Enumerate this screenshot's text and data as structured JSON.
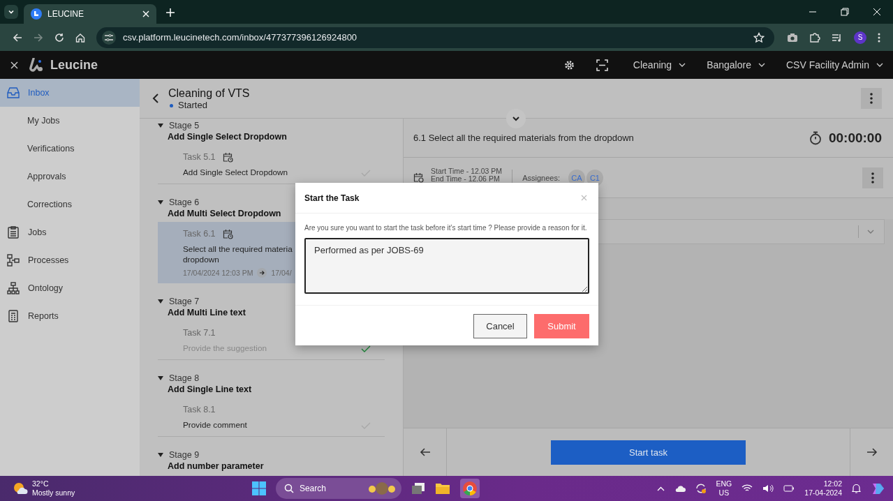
{
  "browser": {
    "tabs": [
      {
        "title": "LEUCINE",
        "selected": true
      }
    ],
    "url": "csv.platform.leucinetech.com/inbox/477377396126924800",
    "profile": "S"
  },
  "header": {
    "brand": "Leucine",
    "selectors": [
      "Cleaning",
      "Bangalore",
      "CSV Facility Admin"
    ]
  },
  "sidebar": {
    "items": [
      {
        "label": "Inbox",
        "kind": "main",
        "selected": true
      },
      {
        "label": "My Jobs",
        "kind": "sub",
        "selected": false
      },
      {
        "label": "Verifications",
        "kind": "sub",
        "selected": false
      },
      {
        "label": "Approvals",
        "kind": "sub",
        "selected": false
      },
      {
        "label": "Corrections",
        "kind": "sub",
        "selected": false
      },
      {
        "label": "Jobs",
        "kind": "main",
        "selected": false
      },
      {
        "label": "Processes",
        "kind": "main",
        "selected": false
      },
      {
        "label": "Ontology",
        "kind": "main",
        "selected": false
      },
      {
        "label": "Reports",
        "kind": "main",
        "selected": false
      }
    ]
  },
  "job": {
    "title": "Cleaning of VTS",
    "status": "Started"
  },
  "stages": [
    {
      "label": "Stage 5",
      "name": "Add Single Select Dropdown",
      "expanded": true,
      "tasks": [
        {
          "number": "Task 5.1",
          "name": "Add Single Select Dropdown",
          "scheduled": true,
          "selected": false,
          "completed": false
        }
      ]
    },
    {
      "label": "Stage 6",
      "name": "Add Multi Select Dropdown",
      "expanded": true,
      "tasks": [
        {
          "number": "Task 6.1",
          "name": "Select all the required materia",
          "name_2": "dropdown",
          "scheduled": true,
          "selected": true,
          "completed": false,
          "start": "17/04/2024 12:03 PM",
          "end": "17/04/"
        }
      ]
    },
    {
      "label": "Stage 7",
      "name": "Add Multi Line text",
      "expanded": true,
      "tasks": [
        {
          "number": "Task 7.1",
          "name": "Provide the suggestion",
          "scheduled": false,
          "selected": false,
          "completed": true
        }
      ]
    },
    {
      "label": "Stage 8",
      "name": "Add Single Line text",
      "expanded": true,
      "tasks": [
        {
          "number": "Task 8.1",
          "name": "Provide comment",
          "scheduled": false,
          "selected": false,
          "completed": false
        }
      ]
    },
    {
      "label": "Stage 9",
      "name": "Add number parameter",
      "expanded": true
    }
  ],
  "task": {
    "title": "6.1 Select all the required materials from the dropdown",
    "timer": "00:00:00",
    "start_time": "Start Time - 12.03 PM",
    "end_time": "End Time - 12.06 PM",
    "assignees_label": "Assignees:",
    "assignees": [
      "CA",
      "C1"
    ],
    "start_button": "Start task"
  },
  "dialog": {
    "title": "Start the Task",
    "message": "Are you sure you want to start the task before it’s start time ? Please provide a reason for it.",
    "reason": "Performed as per JOBS-69",
    "buttons": [
      "Cancel",
      "Submit"
    ]
  },
  "taskbar": {
    "temperature": "32°C",
    "weather": "Mostly sunny",
    "search": "Search",
    "language": "ENG",
    "region": "US",
    "time": "12:02",
    "date": "17-04-2024"
  }
}
